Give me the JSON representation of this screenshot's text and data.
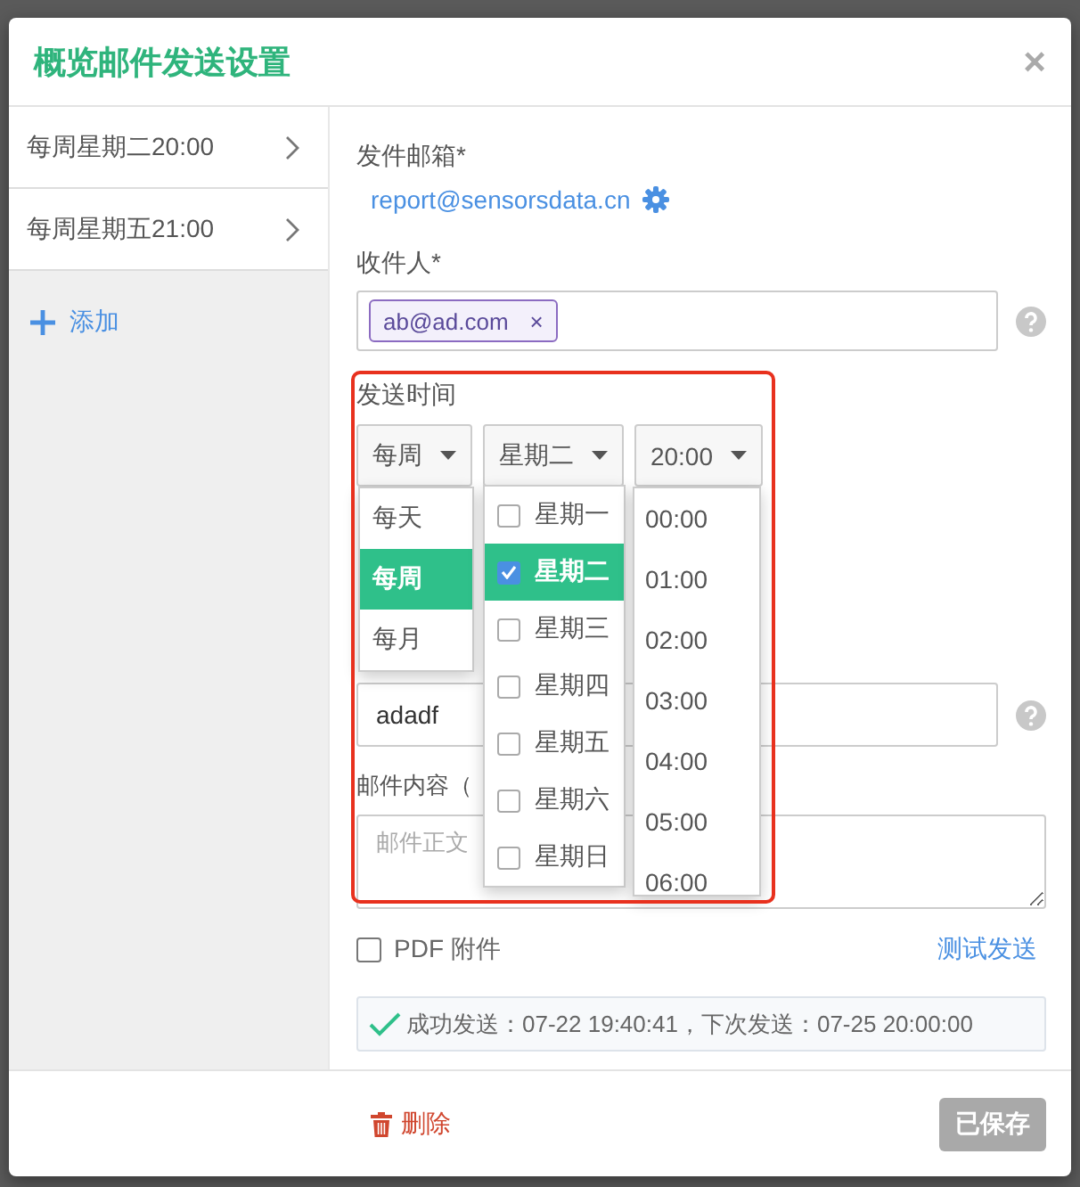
{
  "dialog": {
    "title": "概览邮件发送设置",
    "close": "×"
  },
  "schedules": [
    {
      "label": "每周星期二20:00"
    },
    {
      "label": "每周星期五21:00"
    }
  ],
  "add_button": "添加",
  "form": {
    "sender_label": "发件邮箱*",
    "sender_email": "report@sensorsdata.cn",
    "recipients_label": "收件人*",
    "recipients": [
      {
        "label": "ab@ad.com",
        "remove": "×"
      }
    ],
    "schedule_label": "发送时间",
    "frequency_select": {
      "value": "每周",
      "options": [
        {
          "label": "每天",
          "selected": false
        },
        {
          "label": "每周",
          "selected": true
        },
        {
          "label": "每月",
          "selected": false
        }
      ]
    },
    "weekday_select": {
      "value": "星期二",
      "options": [
        {
          "label": "星期一",
          "checked": false,
          "selected": false
        },
        {
          "label": "星期二",
          "checked": true,
          "selected": true
        },
        {
          "label": "星期三",
          "checked": false,
          "selected": false
        },
        {
          "label": "星期四",
          "checked": false,
          "selected": false
        },
        {
          "label": "星期五",
          "checked": false,
          "selected": false
        },
        {
          "label": "星期六",
          "checked": false,
          "selected": false
        },
        {
          "label": "星期日",
          "checked": false,
          "selected": false
        }
      ]
    },
    "time_select": {
      "value": "20:00",
      "options": [
        "00:00",
        "01:00",
        "02:00",
        "03:00",
        "04:00",
        "05:00",
        "06:00"
      ]
    },
    "title_value": "adadf",
    "content_label": "邮件内容（",
    "content_placeholder": "邮件正文",
    "pdf_attachment": {
      "label": "PDF 附件",
      "checked": false
    },
    "test_send": "测试发送",
    "status": {
      "kind": "success",
      "text": "成功发送：07-22 19:40:41，下次发送：07-25 20:00:00"
    }
  },
  "footer": {
    "delete": "删除",
    "save": {
      "label": "已保存",
      "disabled": true
    }
  }
}
